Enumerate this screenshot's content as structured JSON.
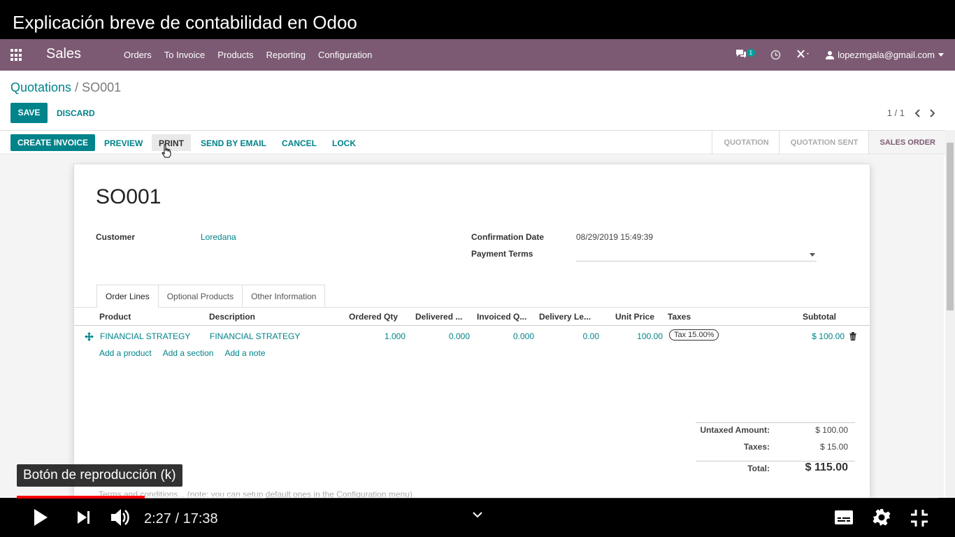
{
  "video": {
    "title": "Explicación breve de contabilidad en Odoo",
    "tooltip": "Botón de reproducción (k)",
    "time": "2:27 / 17:38",
    "progress_fraction": 0.139
  },
  "navbar": {
    "app": "Sales",
    "menu": [
      "Orders",
      "To Invoice",
      "Products",
      "Reporting",
      "Configuration"
    ],
    "messages_badge": "1",
    "user": "lopezmgala@gmail.com"
  },
  "breadcrumb": {
    "parent": "Quotations",
    "separator": "/",
    "current": "SO001"
  },
  "buttons": {
    "save": "SAVE",
    "discard": "DISCARD"
  },
  "pager": {
    "text": "1 / 1"
  },
  "actions": {
    "create_invoice": "CREATE INVOICE",
    "preview": "PREVIEW",
    "print": "PRINT",
    "send_by_email": "SEND BY EMAIL",
    "cancel": "CANCEL",
    "lock": "LOCK"
  },
  "stages": [
    "QUOTATION",
    "QUOTATION SENT",
    "SALES ORDER"
  ],
  "form": {
    "name": "SO001",
    "customer_label": "Customer",
    "customer": "Loredana",
    "confirmation_date_label": "Confirmation Date",
    "confirmation_date": "08/29/2019 15:49:39",
    "payment_terms_label": "Payment Terms"
  },
  "tabs": [
    "Order Lines",
    "Optional Products",
    "Other Information"
  ],
  "table": {
    "headers": [
      "Product",
      "Description",
      "Ordered Qty",
      "Delivered ...",
      "Invoiced Q...",
      "Delivery Le...",
      "Unit Price",
      "Taxes",
      "Subtotal"
    ],
    "row": {
      "product": "FINANCIAL STRATEGY",
      "description": "FINANCIAL STRATEGY",
      "ordered_qty": "1.000",
      "delivered": "0.000",
      "invoiced": "0.000",
      "delivery_lead": "0.00",
      "unit_price": "100.00",
      "tax": "Tax 15.00%",
      "subtotal": "$ 100.00"
    },
    "add_links": [
      "Add a product",
      "Add a section",
      "Add a note"
    ]
  },
  "totals": {
    "untaxed_label": "Untaxed Amount:",
    "untaxed": "$ 100.00",
    "taxes_label": "Taxes:",
    "taxes": "$ 15.00",
    "total_label": "Total:",
    "total": "$ 115.00"
  },
  "terms_placeholder": "Terms and conditions... (note: you can setup default ones in the Configuration menu)"
}
